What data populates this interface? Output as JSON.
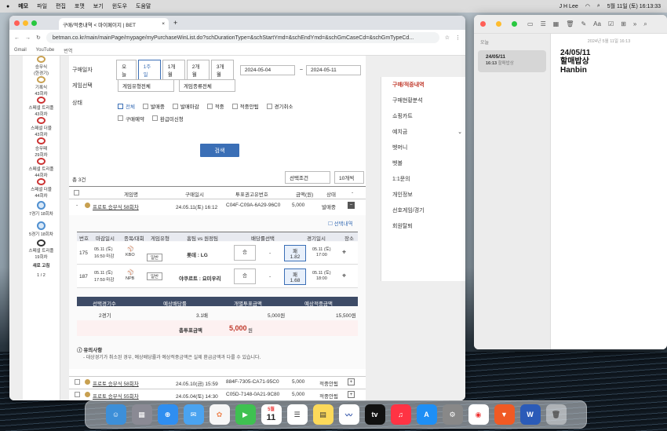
{
  "menubar": {
    "app": "메모",
    "items": [
      "파일",
      "편집",
      "포맷",
      "보기",
      "윈도우",
      "도움말"
    ],
    "user": "J H Lee",
    "date": "5월 11일 (토) 16:13:33"
  },
  "browser": {
    "tab": "구매/적중내역 < 마이페이지 | BET",
    "url": "betman.co.kr/main/mainPage/mypage/myPurchaseWinList.do?schDurationType=&schStartYmd=&schEndYmd=&schGmCaseCd=&schGmTypeCd...",
    "bookmarks": [
      "Gmail",
      "YouTube",
      "번역"
    ]
  },
  "left_sidebar": [
    {
      "label": "승무식",
      "sub": "(한경기)"
    },
    {
      "label": "기록식",
      "sub": "43회차"
    },
    {
      "label": "스페셜 트리플",
      "sub": "43회차"
    },
    {
      "label": "스페셜 더블",
      "sub": "43회차"
    },
    {
      "label": "승무패",
      "sub": "29회차"
    },
    {
      "label": "스페셜 트리플",
      "sub": "44회차"
    },
    {
      "label": "스페셜 더블",
      "sub": "44회차"
    },
    {
      "label": "7경기 18회차",
      "sub": ""
    },
    {
      "label": "5경기 18회차",
      "sub": ""
    },
    {
      "label": "스페셜 트리플",
      "sub": "19회차"
    }
  ],
  "sidebar_footer": {
    "new": "새로 고침",
    "page": "1 / 2"
  },
  "filters": {
    "period_label": "구매일자",
    "period_options": [
      "오늘",
      "1주일",
      "1개월",
      "2개월",
      "3개월"
    ],
    "start": "2024-05-04",
    "end": "2024-05-11",
    "gametype_label": "게임선택",
    "type_sel": "게임유형전체",
    "kind_sel": "게임종류전체",
    "status_label": "상태",
    "statuses": [
      "전체",
      "발매중",
      "발매마감",
      "적중",
      "적중안됨",
      "경기취소",
      "구매예약",
      "환급미신청"
    ],
    "search": "검색"
  },
  "list": {
    "total": "총 3건",
    "sort": "선택조건",
    "per": "10개씩",
    "headers": [
      "게임명",
      "구매일시",
      "투표권고유번호",
      "금액(원)",
      "상태",
      "-"
    ],
    "rows": [
      {
        "game": "프로토 승부식 58회차",
        "date": "24.05.11(토) 16:12",
        "id": "C04F-C09A-6A29-96C0",
        "amount": "5,000",
        "status": "발매중"
      },
      {
        "game": "프로토 승부식 58회차",
        "date": "24.05.10(금) 15:59",
        "id": "884F-7305-CA71-95C0",
        "amount": "5,000",
        "status": "적중안됨"
      },
      {
        "game": "프로토 승부식 55회차",
        "date": "24.05.04(토) 14:30",
        "id": "C05D-7148-0A21-9C80",
        "amount": "5,000",
        "status": "적중안됨"
      }
    ]
  },
  "detail": {
    "select_label": "선택내역",
    "headers": [
      "번호",
      "마감일시",
      "종목/대회",
      "게임유형",
      "홈팀 vs 원정팀",
      "배당률선택",
      "경기일시",
      "장소"
    ],
    "games": [
      {
        "no": "175",
        "close": "05.11 (토)",
        "close2": "16:50 마감",
        "league": "KBO",
        "type": "일반",
        "match": "롯데 : LG",
        "pick_a": "승",
        "pick_draw": "-",
        "pick_b": "패",
        "odd": "1.82",
        "gdate": "05.11 (토)",
        "gtime": "17:00"
      },
      {
        "no": "187",
        "close": "05.11 (토)",
        "close2": "17:50 마감",
        "league": "NPB",
        "type": "일반",
        "match": "야쿠르트 : 요미우리",
        "pick_a": "승",
        "pick_draw": "-",
        "pick_b": "패",
        "odd": "1.68",
        "gdate": "05.11 (토)",
        "gtime": "18:00"
      }
    ],
    "summary_headers": [
      "선택경기수",
      "예상배당률",
      "개별투표금액",
      "예상적중금액"
    ],
    "summary": [
      "2경기",
      "3.1배",
      "5,000원",
      "15,500원"
    ],
    "total_label": "총투표금액",
    "total": "5,000",
    "total_unit": "원",
    "notice_title": "유의사항",
    "notice": "- 대상경기가 취소된 경우, 예상배당률과 예상적중금액은 실제 환급금액과 다를 수 있습니다."
  },
  "right_menu": [
    "구매/적중내역",
    "구매현황분석",
    "쇼핑카트",
    "예치금",
    "벳머니",
    "벳볼",
    "1:1문의",
    "개인정보",
    "선호게임/경기",
    "회원탈퇴"
  ],
  "notes": {
    "section": "오늘",
    "item_title": "24/05/11",
    "item_time": "16:13",
    "item_sub": "할매밥상",
    "header_date": "2024년 5월 11일 16:13",
    "body_line1": "24/05/11",
    "body_line2": "할매밥상",
    "body_line3": "Hanbin"
  },
  "dock": [
    "Finder",
    "Launchpad",
    "Safari",
    "Mail",
    "Photos",
    "FaceTime",
    "Calendar",
    "Reminders",
    "Notes",
    "Freeform",
    "TV",
    "Music",
    "App Store",
    "Settings",
    "Chrome",
    "Brave",
    "Word",
    "Trash"
  ],
  "calendar_day": "11",
  "calendar_month": "5월"
}
